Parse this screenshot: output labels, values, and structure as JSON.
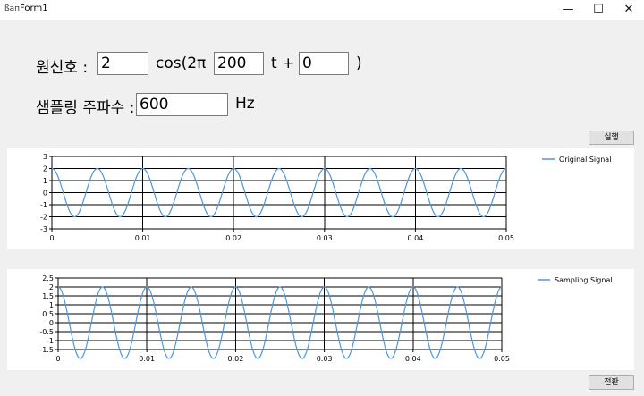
{
  "window": {
    "icon": "ßaп",
    "title": "Form1",
    "min_icon": "minimize-icon",
    "max_icon": "maximize-icon",
    "close_icon": "close-icon"
  },
  "form": {
    "signal_label": "원신호 :",
    "amplitude": "2",
    "cos_text": "cos(2π",
    "frequency": "200",
    "t_plus": "t +",
    "phase": "0",
    "close_paren": ")",
    "sampling_label": "샘플링 주파수 :",
    "sampling_freq": "600",
    "hz": "Hz",
    "run_button": "실행",
    "convert_button": "전환"
  },
  "colors": {
    "series": "#4f96d8",
    "grid": "#000000"
  },
  "chart_data": [
    {
      "type": "line",
      "xlim": [
        0,
        0.05
      ],
      "ylim": [
        -3,
        3
      ],
      "x_ticks": [
        "0",
        "0.01",
        "0.02",
        "0.03",
        "0.04",
        "0.05"
      ],
      "y_ticks": [
        "3",
        "2",
        "1",
        "0",
        "-1",
        "-2",
        "-3"
      ],
      "legend_position": "top-right",
      "series": [
        {
          "name": "Original Signal",
          "function": "2*cos(2*pi*200*t)",
          "amplitude": 2,
          "frequency": 200,
          "phase": 0
        }
      ]
    },
    {
      "type": "line",
      "xlim": [
        0,
        0.05
      ],
      "ylim": [
        -1.5,
        2.5
      ],
      "x_ticks": [
        "0",
        "0.01",
        "0.02",
        "0.03",
        "0.04",
        "0.05"
      ],
      "y_ticks": [
        "2.5",
        "2",
        "1.5",
        "1",
        "0.5",
        "0",
        "-0.5",
        "-1",
        "-1.5"
      ],
      "legend_position": "top-right",
      "series": [
        {
          "name": "Sampling Signal",
          "function": "2*cos(2*pi*200*t)",
          "amplitude": 2,
          "frequency": 200,
          "phase": 0
        }
      ]
    }
  ]
}
